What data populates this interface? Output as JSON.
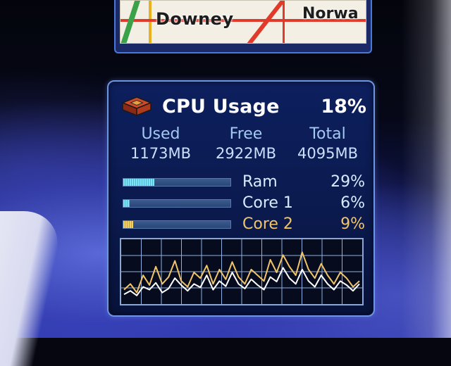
{
  "map_gadget": {
    "labels": {
      "downey": "Downey",
      "norwalk": "Norwa"
    }
  },
  "cpu_gadget": {
    "title": "CPU Usage",
    "total_percent": "18%",
    "icon": "cpu-chip-icon",
    "memory": {
      "used_label": "Used",
      "used_value": "1173MB",
      "free_label": "Free",
      "free_value": "2922MB",
      "total_label": "Total",
      "total_value": "4095MB"
    },
    "meters": [
      {
        "label": "Ram",
        "value": "29%",
        "level": 0.29,
        "color": "#7ee3f2"
      },
      {
        "label": "Core 1",
        "value": "6%",
        "level": 0.06,
        "color": "#7ee3f2"
      },
      {
        "label": "Core 2",
        "value": "9%",
        "level": 0.09,
        "color": "#f2c46a"
      }
    ],
    "history": {
      "core1": [
        0.12,
        0.18,
        0.1,
        0.25,
        0.2,
        0.32,
        0.15,
        0.22,
        0.4,
        0.28,
        0.18,
        0.3,
        0.24,
        0.45,
        0.2,
        0.35,
        0.26,
        0.5,
        0.3,
        0.22,
        0.38,
        0.28,
        0.2,
        0.42,
        0.34,
        0.58,
        0.4,
        0.3,
        0.55,
        0.35,
        0.25,
        0.45,
        0.3,
        0.2,
        0.35,
        0.28,
        0.18,
        0.3
      ],
      "core2": [
        0.2,
        0.3,
        0.15,
        0.45,
        0.28,
        0.6,
        0.3,
        0.42,
        0.7,
        0.35,
        0.25,
        0.5,
        0.4,
        0.62,
        0.3,
        0.55,
        0.38,
        0.68,
        0.42,
        0.3,
        0.55,
        0.45,
        0.35,
        0.72,
        0.5,
        0.8,
        0.6,
        0.45,
        0.85,
        0.55,
        0.4,
        0.65,
        0.45,
        0.3,
        0.5,
        0.4,
        0.25,
        0.35
      ]
    }
  }
}
